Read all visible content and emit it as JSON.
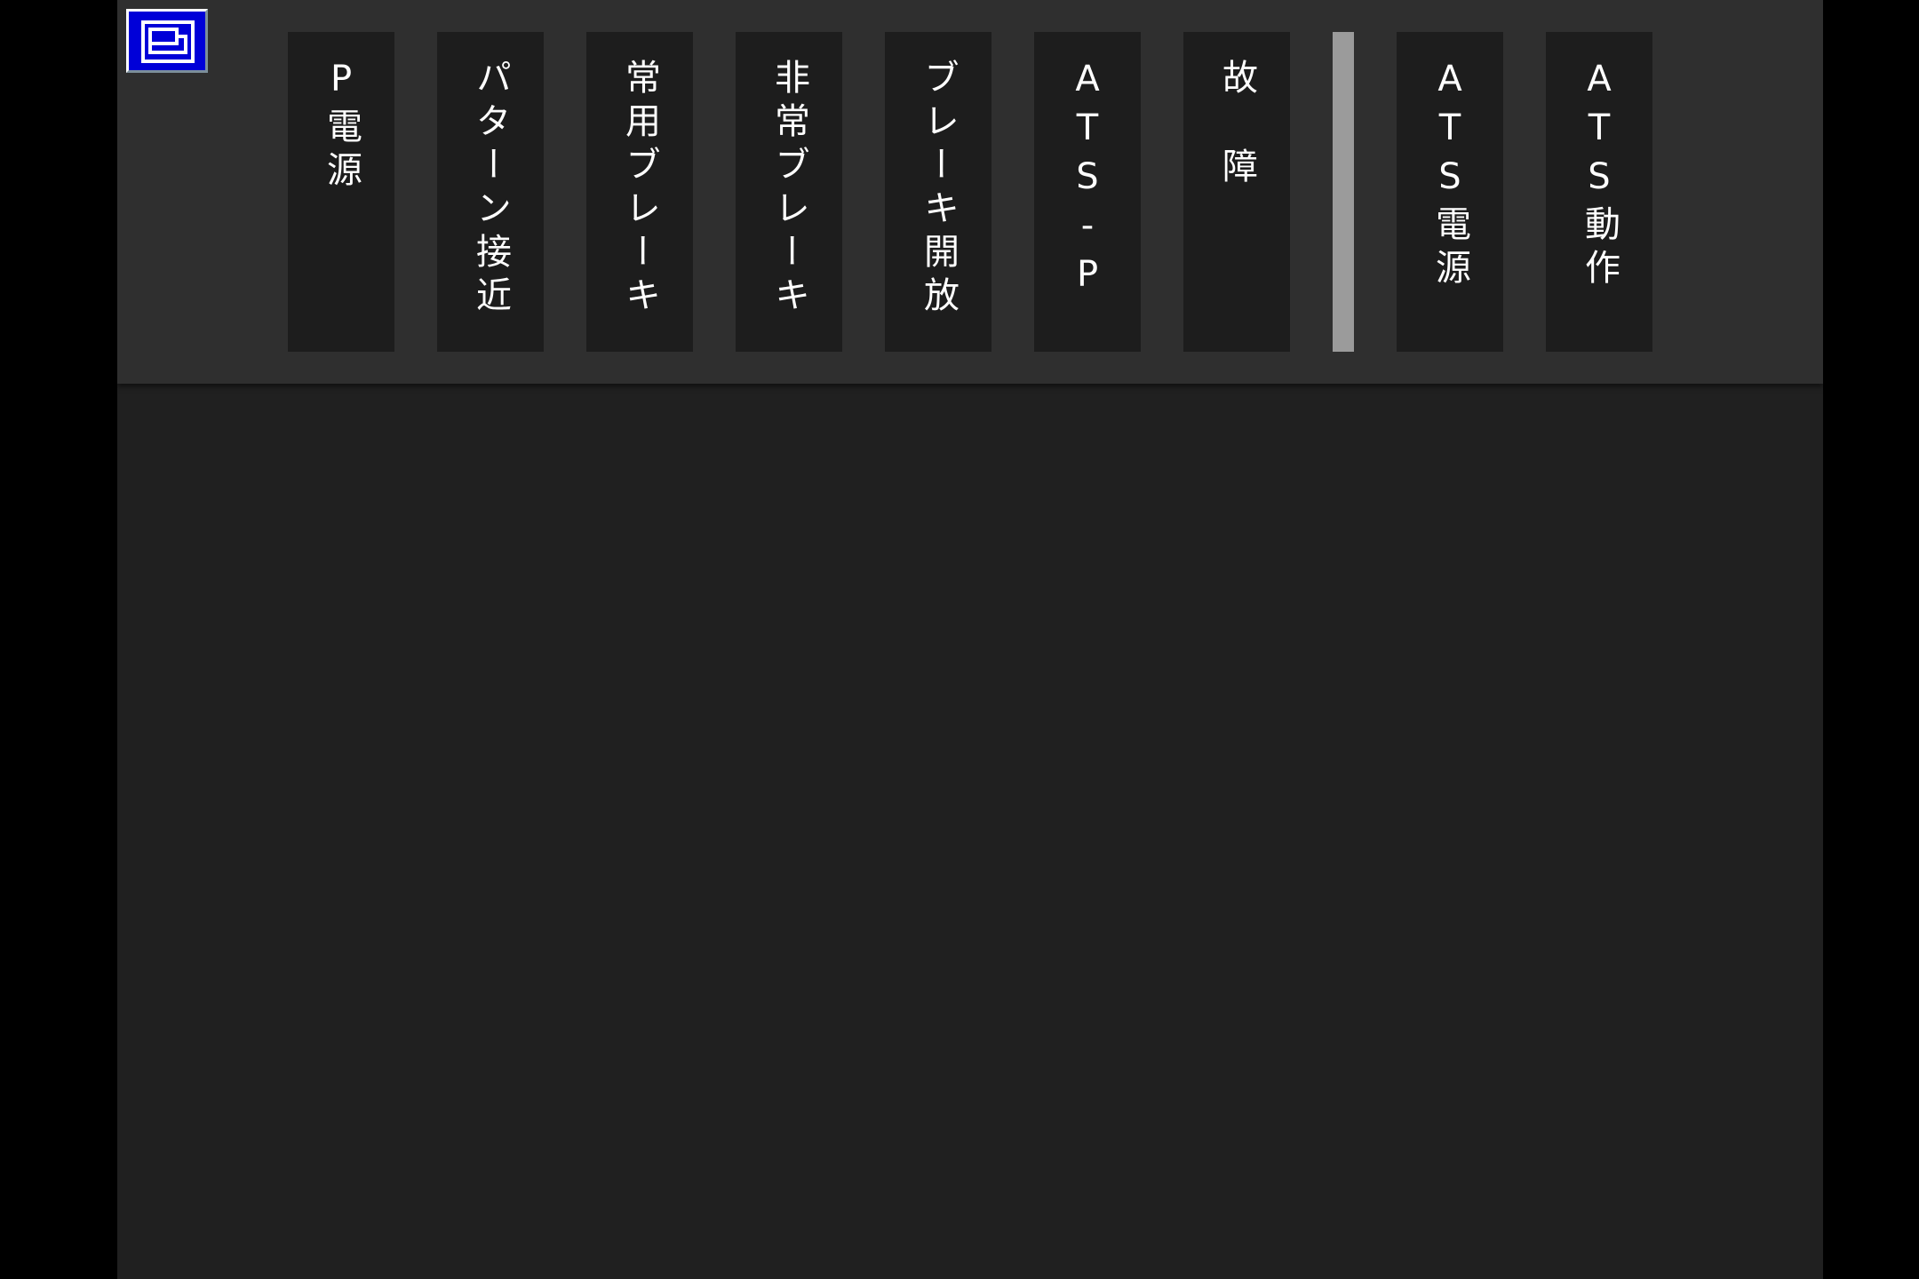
{
  "colors": {
    "outer_background": "#000000",
    "main_background": "#202020",
    "indicator_bar": "#2f2f2f",
    "lamp_off": "#1d1d1d",
    "lamp_text": "#ffffff",
    "separator": "#9b9b9b",
    "window_button": "#0000d8"
  },
  "window_button": {
    "icon": "window-restore-icon"
  },
  "indicators": {
    "group_one": [
      {
        "id": "p-power",
        "label": "P電源"
      },
      {
        "id": "pattern-approach",
        "label": "パターン接近"
      },
      {
        "id": "service-brake",
        "label": "常用ブレーキ"
      },
      {
        "id": "emergency-brake",
        "label": "非常ブレーキ"
      },
      {
        "id": "brake-release",
        "label": "ブレーキ開放"
      },
      {
        "id": "ats-p",
        "label": "ATS-P"
      },
      {
        "id": "fault",
        "label": "故障"
      }
    ],
    "group_two": [
      {
        "id": "ats-power",
        "label": "ATS電源"
      },
      {
        "id": "ats-operation",
        "label": "ATS動作"
      }
    ]
  }
}
